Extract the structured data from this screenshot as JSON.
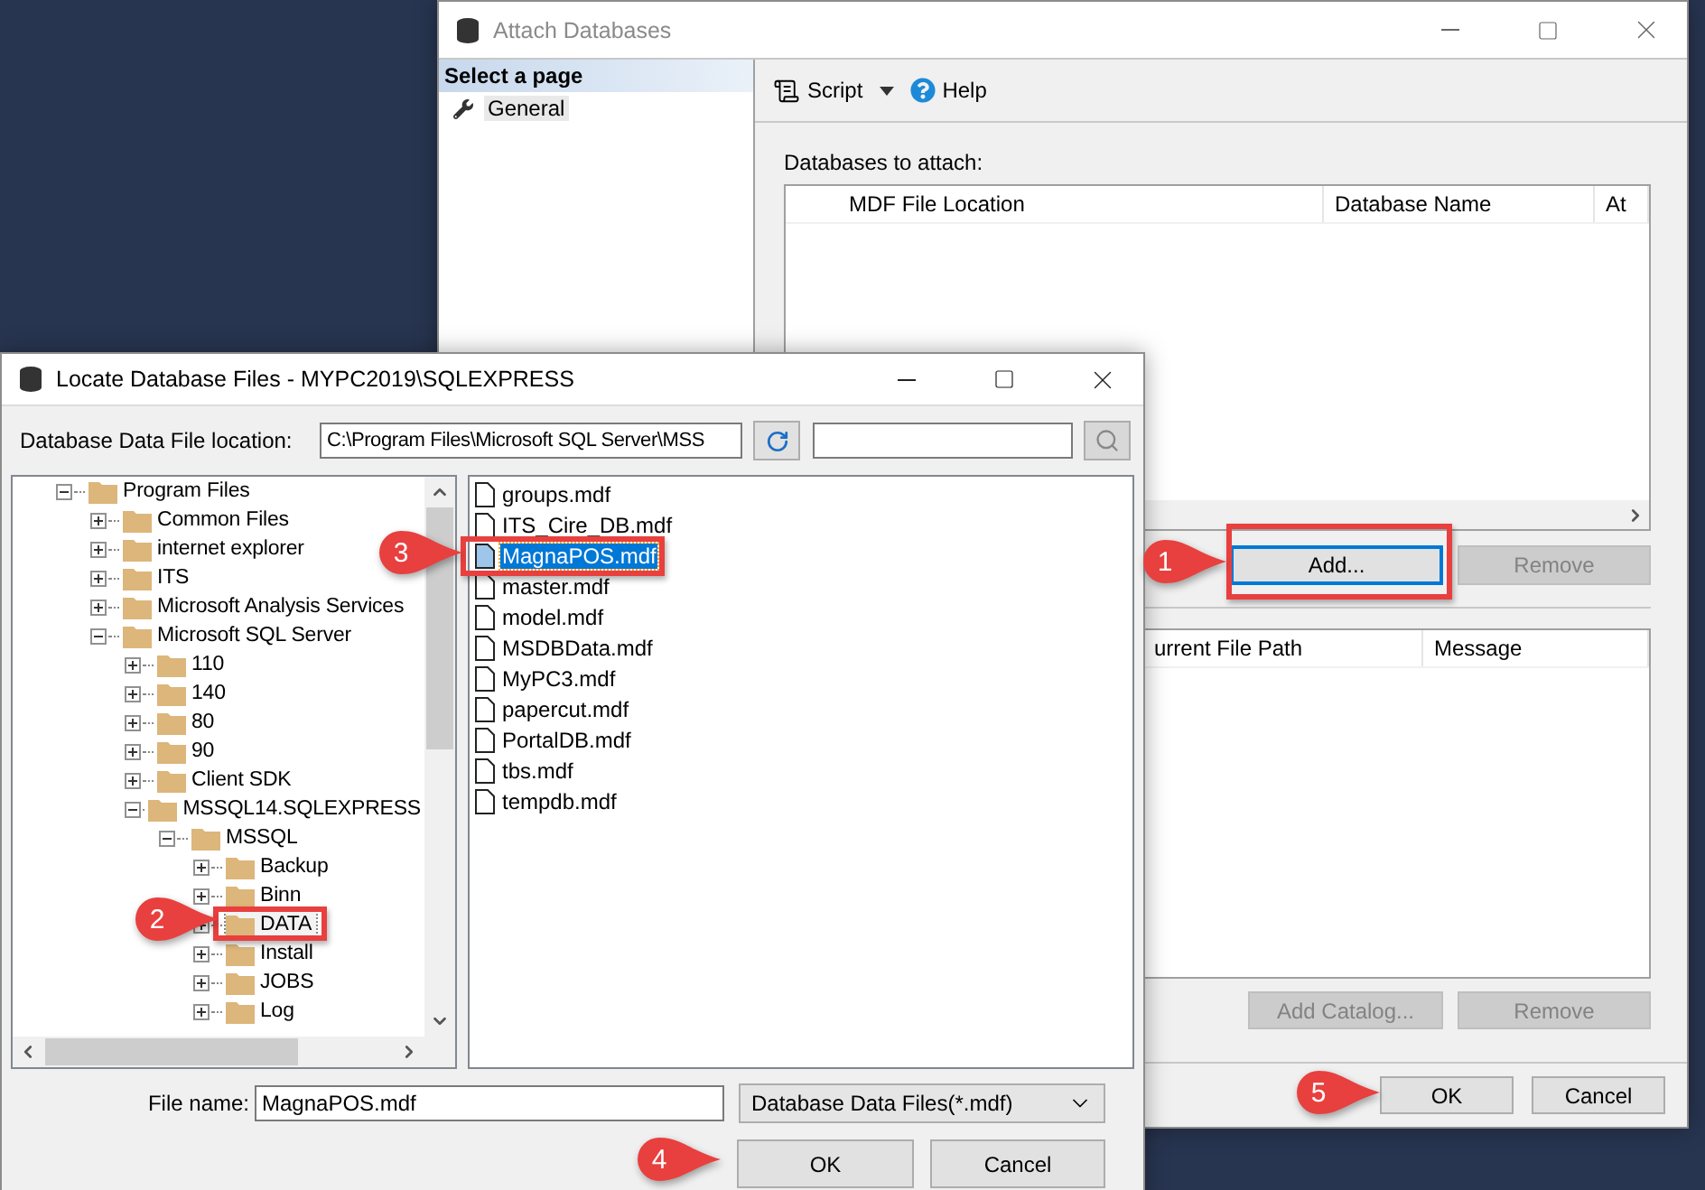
{
  "attach_window": {
    "title": "Attach Databases",
    "active": false,
    "sidebar": {
      "heading": "Select a page",
      "items": [
        {
          "label": "General",
          "selected": true
        }
      ]
    },
    "toolbar": {
      "items": [
        {
          "label": "Script",
          "kind": "script"
        },
        {
          "label": "Help",
          "kind": "help"
        }
      ]
    },
    "databases_label": "Databases to attach:",
    "databases_grid": {
      "columns": [
        "MDF File Location",
        "Database Name",
        "At"
      ]
    },
    "buttons": [
      {
        "label": "Add...",
        "focused": true,
        "disabled": false
      },
      {
        "label": "Remove",
        "focused": false,
        "disabled": true
      }
    ],
    "details_grid": {
      "columns": [
        "urrent File Path",
        "Message"
      ]
    },
    "details_buttons": [
      {
        "label": "Add Catalog...",
        "disabled": true
      },
      {
        "label": "Remove",
        "disabled": true
      }
    ],
    "footer_buttons": [
      {
        "label": "OK"
      },
      {
        "label": "Cancel"
      }
    ]
  },
  "locate_dialog": {
    "title": "Locate Database Files - MYPC2019\\SQLEXPRESS",
    "active": true,
    "location_label": "Database Data File location:",
    "location_value": "C:\\Program Files\\Microsoft SQL Server\\MSS",
    "tree": [
      {
        "label": "Program Files",
        "expanded": true,
        "selected": false,
        "children": [
          {
            "label": "Common Files",
            "expanded": false,
            "selected": false
          },
          {
            "label": "internet explorer",
            "expanded": false,
            "selected": false
          },
          {
            "label": "ITS",
            "expanded": false,
            "selected": false
          },
          {
            "label": "Microsoft Analysis Services",
            "expanded": false,
            "selected": false
          },
          {
            "label": "Microsoft SQL Server",
            "expanded": true,
            "selected": false,
            "children": [
              {
                "label": "110",
                "expanded": false,
                "selected": false
              },
              {
                "label": "140",
                "expanded": false,
                "selected": false
              },
              {
                "label": "80",
                "expanded": false,
                "selected": false
              },
              {
                "label": "90",
                "expanded": false,
                "selected": false
              },
              {
                "label": "Client SDK",
                "expanded": false,
                "selected": false
              },
              {
                "label": "MSSQL14.SQLEXPRESS",
                "expanded": true,
                "selected": false,
                "children": [
                  {
                    "label": "MSSQL",
                    "expanded": true,
                    "selected": false,
                    "children": [
                      {
                        "label": "Backup",
                        "expanded": false,
                        "selected": false
                      },
                      {
                        "label": "Binn",
                        "expanded": false,
                        "selected": false
                      },
                      {
                        "label": "DATA",
                        "expanded": false,
                        "selected": true
                      },
                      {
                        "label": "Install",
                        "expanded": false,
                        "selected": false
                      },
                      {
                        "label": "JOBS",
                        "expanded": false,
                        "selected": false
                      },
                      {
                        "label": "Log",
                        "expanded": false,
                        "selected": false
                      }
                    ]
                  }
                ]
              }
            ]
          }
        ]
      }
    ],
    "files": [
      {
        "name": "groups.mdf",
        "selected": false
      },
      {
        "name": "ITS_Cire_DB.mdf",
        "selected": false
      },
      {
        "name": "MagnaPOS.mdf",
        "selected": true
      },
      {
        "name": "master.mdf",
        "selected": false
      },
      {
        "name": "model.mdf",
        "selected": false
      },
      {
        "name": "MSDBData.mdf",
        "selected": false
      },
      {
        "name": "MyPC3.mdf",
        "selected": false
      },
      {
        "name": "papercut.mdf",
        "selected": false
      },
      {
        "name": "PortalDB.mdf",
        "selected": false
      },
      {
        "name": "tbs.mdf",
        "selected": false
      },
      {
        "name": "tempdb.mdf",
        "selected": false
      }
    ],
    "file_name_label": "File name:",
    "file_name_value": "MagnaPOS.mdf",
    "file_type": "Database Data Files(*.mdf)",
    "buttons": [
      {
        "label": "OK"
      },
      {
        "label": "Cancel"
      }
    ]
  },
  "callouts": [
    {
      "number": "1"
    },
    {
      "number": "2"
    },
    {
      "number": "3"
    },
    {
      "number": "4"
    },
    {
      "number": "5"
    }
  ]
}
